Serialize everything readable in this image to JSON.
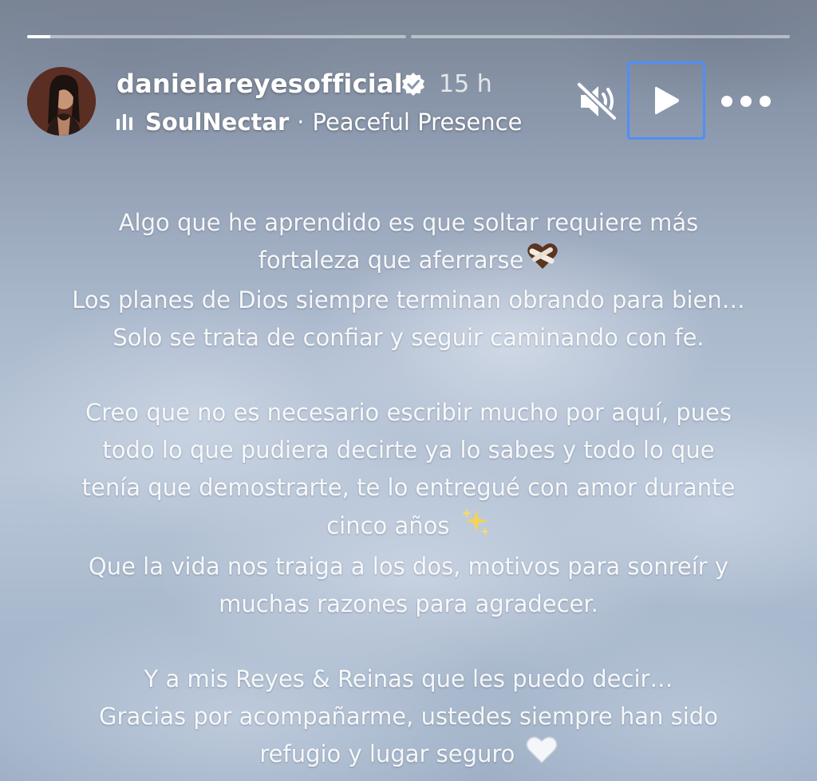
{
  "story": {
    "progress": [
      0.06,
      0.0
    ],
    "username": "danielareyesofficial",
    "time": "15 h",
    "music": {
      "artist": "SoulNectar",
      "separator": "·",
      "song": "Peaceful Presence"
    }
  },
  "icons": {
    "verified": "verified-badge-icon",
    "music": "music-bars-icon",
    "mute": "speaker-muted-icon",
    "play": "play-icon",
    "more": "more-horizontal-icon"
  },
  "caption": {
    "p1": [
      "Algo que he aprendido es que soltar requiere más",
      "fortaleza que aferrarse",
      "Los planes de Dios siempre terminan obrando para bien…",
      "Solo se trata de confiar y seguir caminando con  fe."
    ],
    "p2": [
      "Creo que no es necesario escribir mucho por aquí, pues",
      "todo lo que pudiera decirte ya lo sabes y todo lo que",
      "tenía que demostrarte, te lo entregué con amor durante",
      "cinco años",
      "Que la vida nos traiga a los dos, motivos para sonreír y",
      "muchas razones para agradecer."
    ],
    "p3": [
      "Y a mis Reyes & Reinas que les puedo decir…",
      "Gracias por acompañarme,  ustedes siempre han sido",
      "refugio y lugar seguro"
    ],
    "emojis": {
      "heart_brown": "brown-heart-bandaged-icon",
      "sparkles": "sparkles-icon",
      "heart_white": "white-heart-icon"
    }
  }
}
